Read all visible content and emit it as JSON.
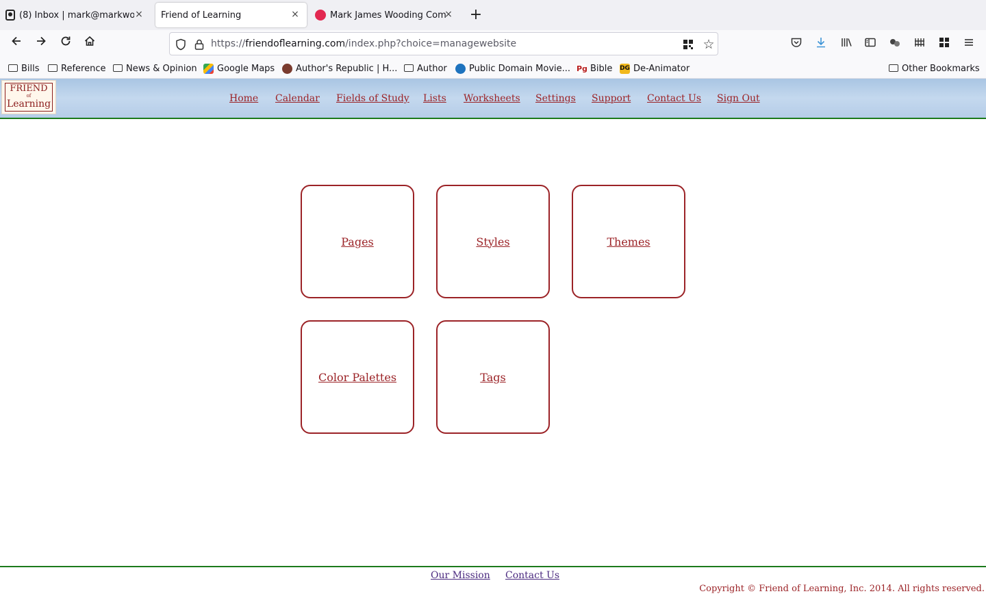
{
  "browser": {
    "tabs": [
      {
        "title": "(8) Inbox | mark@markwo",
        "icon": "mail-icon"
      },
      {
        "title": "Friend of Learning",
        "icon": "none"
      },
      {
        "title": "Mark James Wooding Com",
        "icon": "red-dot-icon"
      }
    ],
    "new_tab": "+",
    "close_glyph": "×",
    "url_prefix": "https://",
    "url_domain": "friendoflearning.com",
    "url_path": "/index.php?choice=managewebsite",
    "bookmarks": [
      {
        "label": "Bills",
        "icon": "folder-icon"
      },
      {
        "label": "Reference",
        "icon": "folder-icon"
      },
      {
        "label": "News & Opinion",
        "icon": "folder-icon"
      },
      {
        "label": "Google Maps",
        "icon": "maps-icon"
      },
      {
        "label": "Author's Republic | H...",
        "icon": "authors-republic-icon"
      },
      {
        "label": "Author",
        "icon": "folder-icon"
      },
      {
        "label": "Public Domain Movie...",
        "icon": "drupal-icon"
      },
      {
        "label": "Bible",
        "icon": "bible-icon"
      },
      {
        "label": "De-Animator",
        "icon": "deanimator-icon"
      }
    ],
    "other_bookmarks": "Other Bookmarks",
    "favicon_text": {
      "bible": "Pg",
      "deanimator": "DG"
    }
  },
  "site": {
    "logo": {
      "line1": "FRIEND",
      "line2": "of",
      "line3": "Learning"
    },
    "nav": [
      "Home",
      "Calendar",
      "Fields of Study",
      "Lists",
      "Worksheets",
      "Settings",
      "Support",
      "Contact Us",
      "Sign Out"
    ],
    "tiles": [
      "Pages",
      "Styles",
      "Themes",
      "Color Palettes",
      "Tags"
    ],
    "footer": {
      "links": [
        "Our Mission",
        "Contact Us"
      ],
      "copyright": "Copyright © Friend of Learning, Inc. 2014. All rights reserved."
    },
    "colors": {
      "accent": "#9b2226",
      "divider": "#1b7a1b",
      "header_sky": "#b5cde8",
      "footer_link": "#4b2a80"
    }
  }
}
